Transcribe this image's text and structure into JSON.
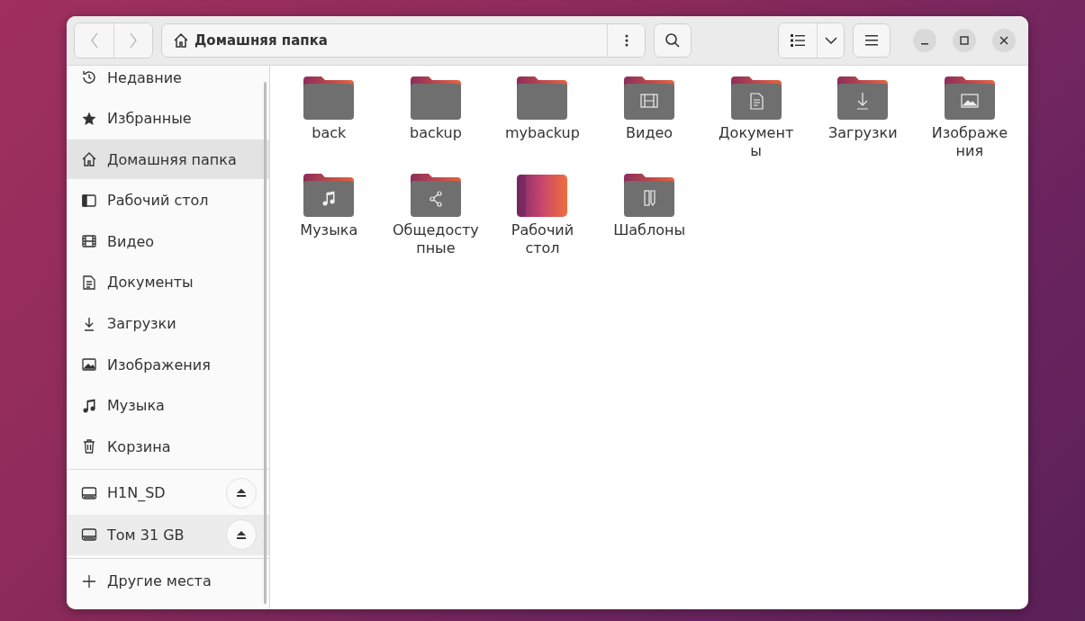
{
  "header": {
    "location": "Домашняя папка"
  },
  "sidebar": {
    "places": [
      {
        "label": "Недавние",
        "kind": "recent",
        "selected": false
      },
      {
        "label": "Избранные",
        "kind": "star",
        "selected": false
      },
      {
        "label": "Домашняя папка",
        "kind": "home",
        "selected": true
      },
      {
        "label": "Рабочий стол",
        "kind": "desktop",
        "selected": false
      },
      {
        "label": "Видео",
        "kind": "video",
        "selected": false
      },
      {
        "label": "Документы",
        "kind": "document",
        "selected": false
      },
      {
        "label": "Загрузки",
        "kind": "download",
        "selected": false
      },
      {
        "label": "Изображения",
        "kind": "image",
        "selected": false
      },
      {
        "label": "Музыка",
        "kind": "music",
        "selected": false
      },
      {
        "label": "Корзина",
        "kind": "trash",
        "selected": false
      }
    ],
    "devices": [
      {
        "label": "H1N_SD",
        "hovered": false
      },
      {
        "label": "Том 31 GB",
        "hovered": true
      }
    ],
    "other": {
      "label": "Другие места"
    }
  },
  "files": [
    {
      "lines": [
        "back"
      ],
      "kind": "folder"
    },
    {
      "lines": [
        "backup"
      ],
      "kind": "folder"
    },
    {
      "lines": [
        "mybackup"
      ],
      "kind": "folder"
    },
    {
      "lines": [
        "Видео"
      ],
      "kind": "video"
    },
    {
      "lines": [
        "Документ",
        "ы"
      ],
      "kind": "document"
    },
    {
      "lines": [
        "Загрузки"
      ],
      "kind": "download"
    },
    {
      "lines": [
        "Изображе",
        "ния"
      ],
      "kind": "image"
    },
    {
      "lines": [
        "Музыка"
      ],
      "kind": "music"
    },
    {
      "lines": [
        "Общедосту",
        "пные"
      ],
      "kind": "share"
    },
    {
      "lines": [
        "Рабочий",
        "стол"
      ],
      "kind": "desktop"
    },
    {
      "lines": [
        "Шаблоны"
      ],
      "kind": "templates"
    }
  ]
}
